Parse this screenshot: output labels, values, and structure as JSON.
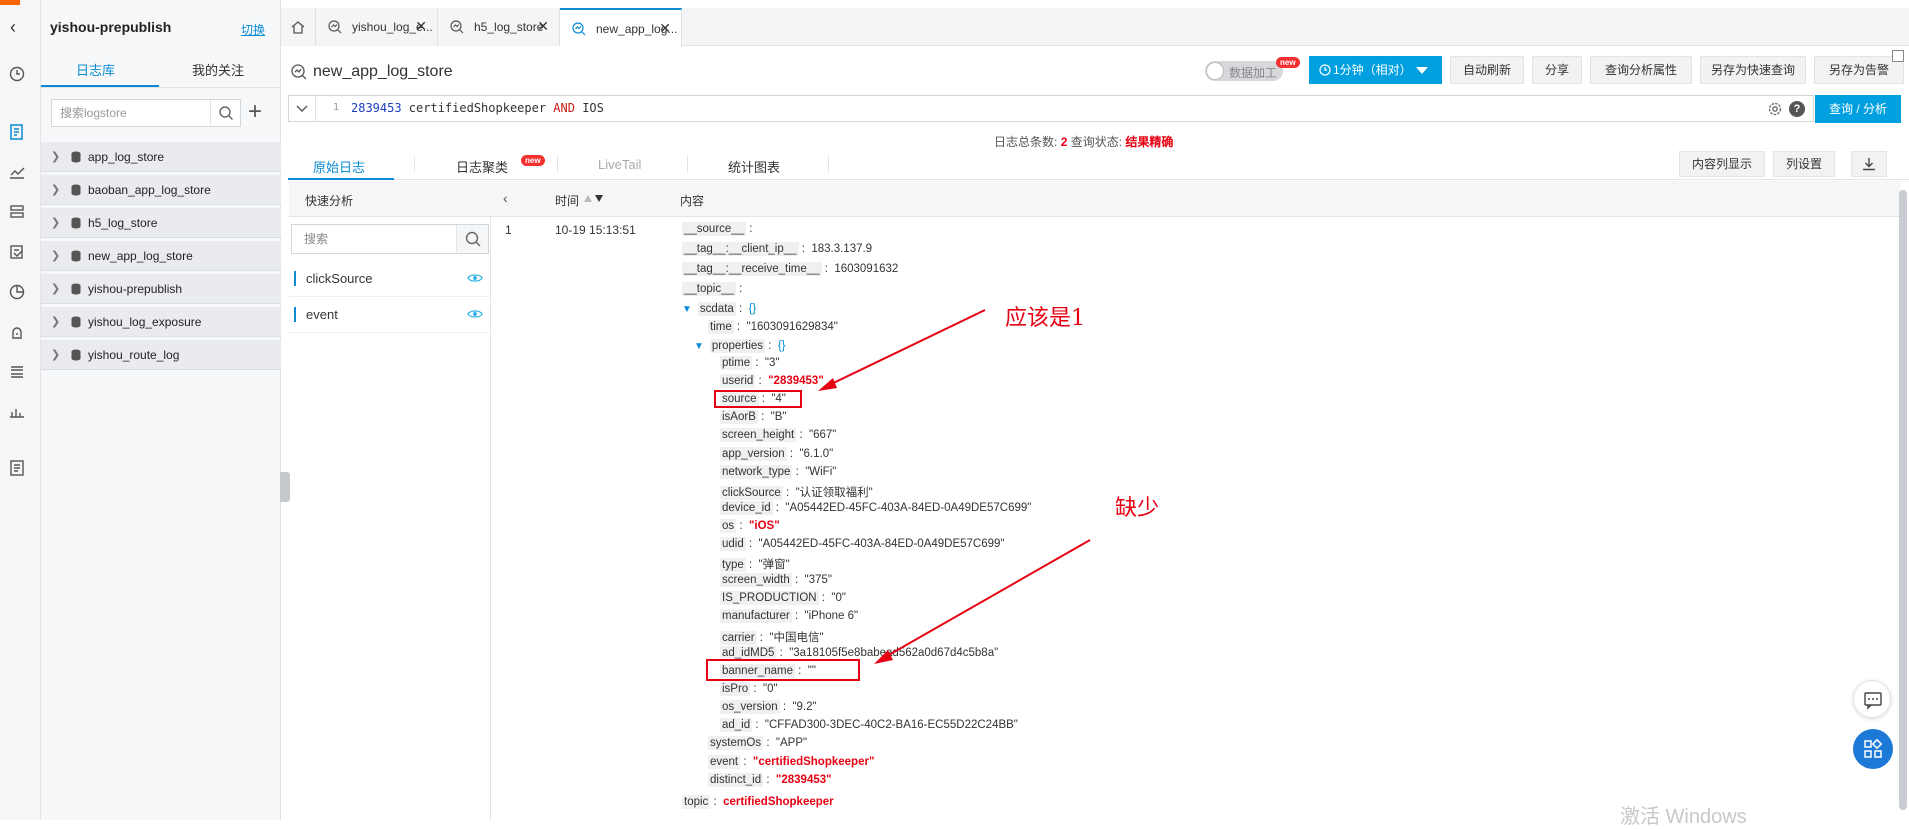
{
  "sidebar": {
    "project": "yishou-prepublish",
    "switch_label": "切换",
    "tabs": [
      "日志库",
      "我的关注"
    ],
    "search_placeholder": "搜索logstore",
    "stores": [
      "app_log_store",
      "baoban_app_log_store",
      "h5_log_store",
      "new_app_log_store",
      "yishou-prepublish",
      "yishou_log_exposure",
      "yishou_route_log"
    ]
  },
  "window_tabs": [
    {
      "label": "yishou_log_e..."
    },
    {
      "label": "h5_log_store"
    },
    {
      "label": "new_app_log..."
    }
  ],
  "header": {
    "title": "new_app_log_store",
    "data_process": "数据加工",
    "new_badge": "new",
    "time_range": "1分钟（相对）",
    "auto_refresh": "自动刷新",
    "share": "分享",
    "query_props": "查询分析属性",
    "save_quick": "另存为快速查询",
    "save_alert": "另存为告警"
  },
  "query": {
    "line_no": "1",
    "tokens": {
      "num": "2839453",
      "a": " certifiedShopkeeper ",
      "and": "AND",
      "b": " IOS"
    },
    "button": "查询 / 分析"
  },
  "stats": {
    "total_label": "日志总条数:",
    "total": "2",
    "status_label": "查询状态:",
    "status": "结果精确"
  },
  "subtabs": {
    "raw": "原始日志",
    "cluster": "日志聚类",
    "cluster_badge": "new",
    "livetail": "LiveTail",
    "chart": "统计图表",
    "content_col": "内容列显示",
    "col_settings": "列设置"
  },
  "quick_analysis": {
    "title": "快速分析",
    "search_placeholder": "搜索",
    "fields": [
      "clickSource",
      "event"
    ]
  },
  "log_table": {
    "headers": {
      "time": "时间",
      "content": "内容"
    },
    "row": {
      "index": "1",
      "time": "10-19 15:13:51"
    }
  },
  "log_entry": {
    "source_key": "__source__",
    "client_ip_key": "__tag__:__client_ip__",
    "client_ip": "183.3.137.9",
    "receive_time_key": "__tag__:__receive_time__",
    "receive_time": "1603091632",
    "topic_key": "__topic__",
    "scdata_key": "scdata",
    "braces": "{}",
    "time_key": "time",
    "time": "\"1603091629834\"",
    "properties_key": "properties",
    "props": [
      {
        "k": "ptime",
        "v": "\"3\""
      },
      {
        "k": "userid",
        "v": "\"2839453\"",
        "hl": true
      },
      {
        "k": "source",
        "v": "\"4\""
      },
      {
        "k": "isAorB",
        "v": "\"B\""
      },
      {
        "k": "screen_height",
        "v": "\"667\""
      },
      {
        "k": "app_version",
        "v": "\"6.1.0\""
      },
      {
        "k": "network_type",
        "v": "\"WiFi\""
      },
      {
        "k": "clickSource",
        "v": "\"认证领取福利\""
      },
      {
        "k": "device_id",
        "v": "\"A05442ED-45FC-403A-84ED-0A49DE57C699\""
      },
      {
        "k": "os",
        "v": "\"iOS\"",
        "hl": true
      },
      {
        "k": "udid",
        "v": "\"A05442ED-45FC-403A-84ED-0A49DE57C699\""
      },
      {
        "k": "type",
        "v": "\"弹窗\""
      },
      {
        "k": "screen_width",
        "v": "\"375\""
      },
      {
        "k": "IS_PRODUCTION",
        "v": "\"0\""
      },
      {
        "k": "manufacturer",
        "v": "\"iPhone 6\""
      },
      {
        "k": "carrier",
        "v": "\"中国电信\""
      },
      {
        "k": "ad_idMD5",
        "v": "\"3a18105f5e8babead562a0d67d4c5b8a\""
      },
      {
        "k": "banner_name",
        "v": "\"\""
      },
      {
        "k": "isPro",
        "v": "\"0\""
      },
      {
        "k": "os_version",
        "v": "\"9.2\""
      },
      {
        "k": "ad_id",
        "v": "\"CFFAD300-3DEC-40C2-BA16-EC55D22C24BB\""
      }
    ],
    "systemOs_key": "systemOs",
    "systemOs": "\"APP\"",
    "event_key": "event",
    "event": "\"certifiedShopkeeper\"",
    "distinct_key": "distinct_id",
    "distinct": "\"2839453\"",
    "topic2_key": "topic",
    "topic2": "certifiedShopkeeper"
  },
  "annotations": {
    "note1": "应该是1",
    "note2": "缺少"
  },
  "watermark": "激活 Windows",
  "colors": {
    "accent": "#00a0e0",
    "link": "#0a8bd4",
    "highlight": "#e60012"
  }
}
